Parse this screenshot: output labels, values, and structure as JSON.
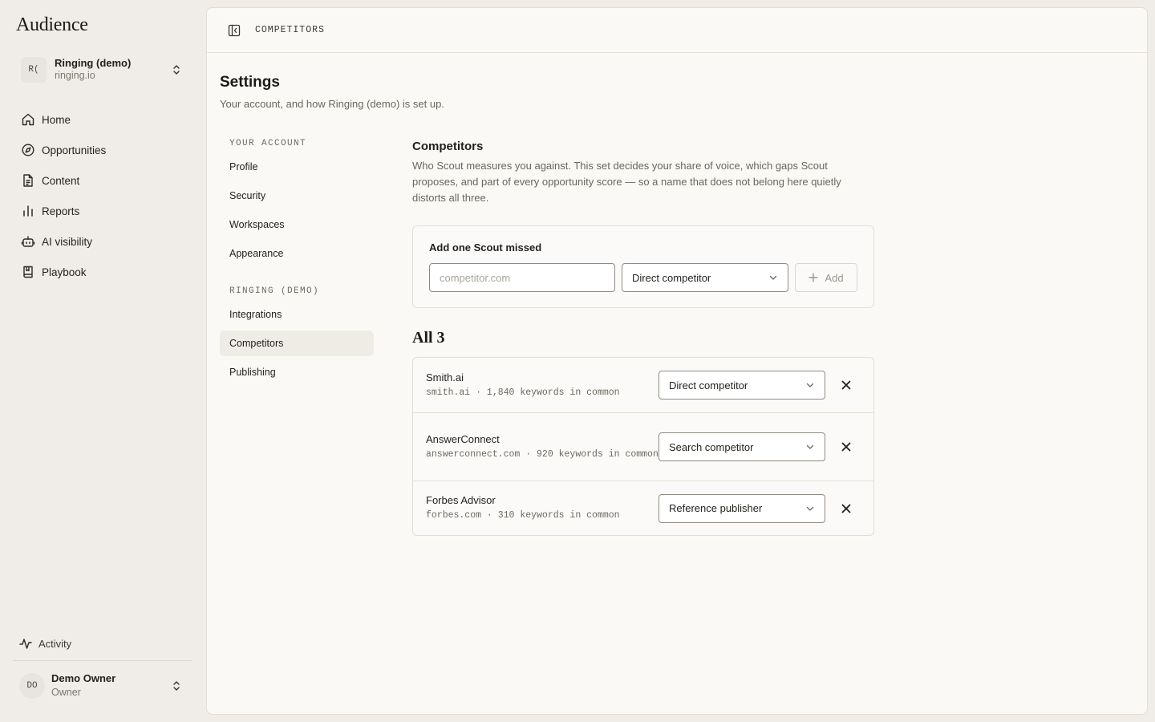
{
  "app": {
    "name": "Audience"
  },
  "workspace": {
    "avatar": "R(",
    "name": "Ringing (demo)",
    "domain": "ringing.io"
  },
  "nav": [
    {
      "label": "Home",
      "icon": "home-icon"
    },
    {
      "label": "Opportunities",
      "icon": "compass-icon"
    },
    {
      "label": "Content",
      "icon": "document-icon"
    },
    {
      "label": "Reports",
      "icon": "bar-chart-icon"
    },
    {
      "label": "AI visibility",
      "icon": "robot-icon"
    },
    {
      "label": "Playbook",
      "icon": "book-icon"
    }
  ],
  "activity": {
    "label": "Activity",
    "icon": "activity-pulse-icon"
  },
  "user": {
    "avatar": "DO",
    "name": "Demo Owner",
    "role": "Owner"
  },
  "breadcrumb": "COMPETITORS",
  "page": {
    "title": "Settings",
    "subtitle": "Your account, and how Ringing (demo) is set up."
  },
  "settings_nav": {
    "account_heading": "YOUR ACCOUNT",
    "account_items": [
      "Profile",
      "Security",
      "Workspaces",
      "Appearance"
    ],
    "workspace_heading": "RINGING (DEMO)",
    "workspace_items": [
      "Integrations",
      "Competitors",
      "Publishing"
    ],
    "active": "Competitors"
  },
  "competitors": {
    "title": "Competitors",
    "description": "Who Scout measures you against. This set decides your share of voice, which gaps Scout proposes, and part of every opportunity score — so a name that does not belong here quietly distorts all three.",
    "add_card": {
      "label": "Add one Scout missed",
      "input_placeholder": "competitor.com",
      "input_value": "",
      "type_selected": "Direct competitor",
      "add_label": "Add"
    },
    "list_title": "All 3",
    "items": [
      {
        "name": "Smith.ai",
        "meta": "smith.ai · 1,840 keywords in common",
        "type": "Direct competitor"
      },
      {
        "name": "AnswerConnect",
        "meta": "answerconnect.com · 920 keywords in common",
        "type": "Search competitor"
      },
      {
        "name": "Forbes Advisor",
        "meta": "forbes.com · 310 keywords in common",
        "type": "Reference publisher"
      }
    ]
  }
}
